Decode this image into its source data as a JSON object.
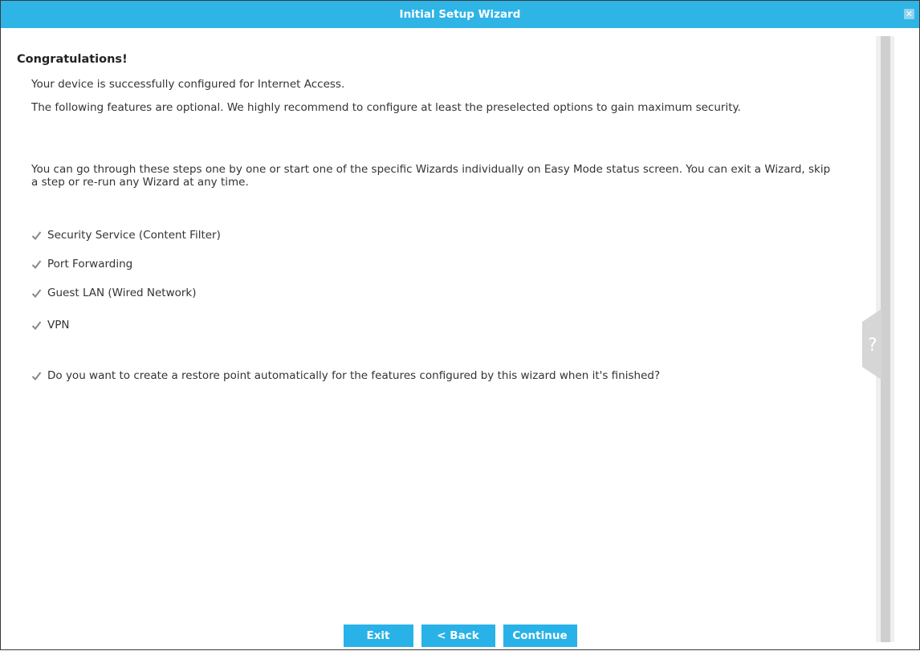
{
  "window": {
    "title": "Initial Setup Wizard",
    "close_icon": "close-icon"
  },
  "content": {
    "heading": "Congratulations!",
    "intro": "Your device is successfully configured for Internet Access.",
    "optional_text": "The following features are optional. We highly recommend to configure at least the preselected options to gain maximum security.",
    "steps_text": "You can go through these steps one by one or start one of the specific Wizards individually on Easy Mode status screen. You can exit a Wizard, skip a step or re-run any Wizard at any time.",
    "options": [
      {
        "label": "Security Service (Content Filter)",
        "checked": true
      },
      {
        "label": "Port Forwarding",
        "checked": true
      },
      {
        "label": "Guest LAN (Wired Network)",
        "checked": true
      },
      {
        "label": "VPN",
        "checked": true
      }
    ],
    "restore_point": {
      "label": "Do you want to create a restore point automatically for the features configured by this wizard when it's finished?",
      "checked": true
    }
  },
  "help_tab": {
    "glyph": "?"
  },
  "footer": {
    "exit_label": "Exit",
    "back_label": "< Back",
    "continue_label": "Continue"
  },
  "colors": {
    "titlebar": "#2fb4e6",
    "button": "#28b2e8",
    "checkmark": "#888888"
  }
}
